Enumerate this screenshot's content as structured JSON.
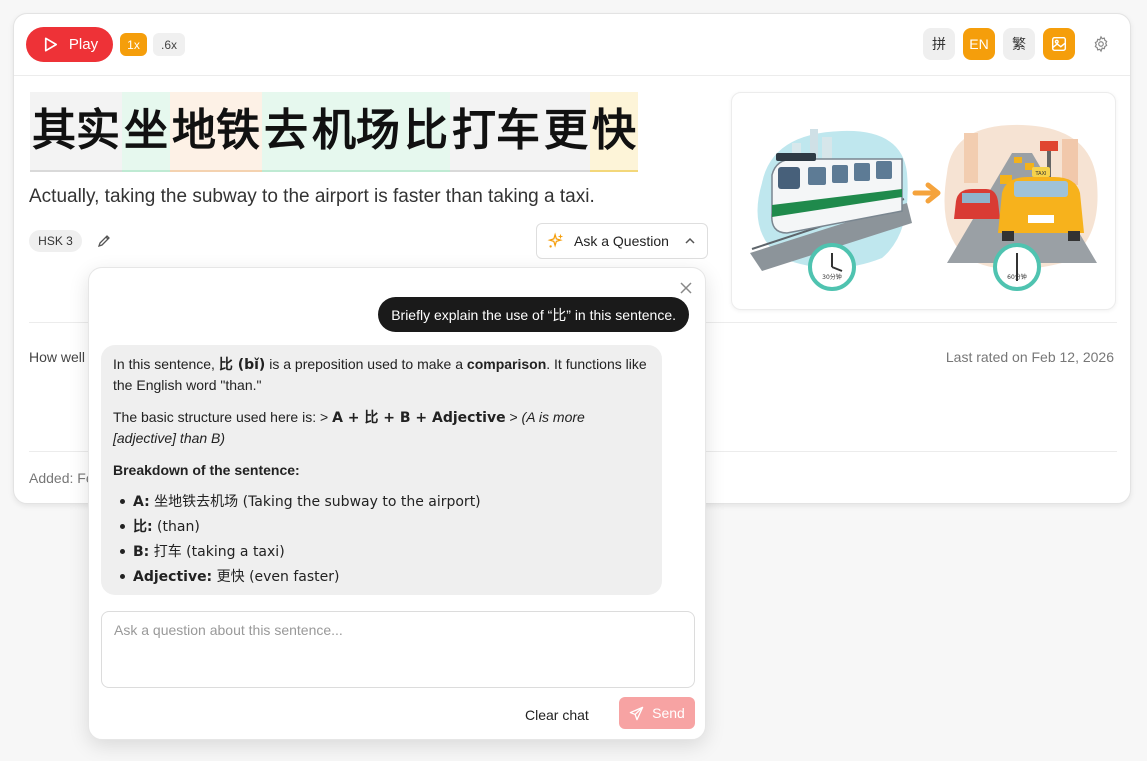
{
  "toolbar": {
    "play_label": "Play",
    "speed_1x": "1x",
    "speed_6x": ".6x",
    "pinyin_label": "拼",
    "english_label": "EN",
    "traditional_label": "繁",
    "image_icon": "image-icon",
    "settings_icon": "gear-icon"
  },
  "sentence": {
    "words": [
      {
        "text": "其实",
        "style": "gray"
      },
      {
        "text": "坐",
        "style": "green"
      },
      {
        "text": "地铁",
        "style": "orange"
      },
      {
        "text": "去",
        "style": "green"
      },
      {
        "text": "机场",
        "style": "green"
      },
      {
        "text": "比",
        "style": "green"
      },
      {
        "text": "打车",
        "style": "gray"
      },
      {
        "text": "更",
        "style": "gray"
      },
      {
        "text": "快",
        "style": "yellow"
      }
    ],
    "translation": "Actually, taking the subway to the airport is faster than taking a taxi.",
    "hsk": "HSK 3"
  },
  "ask_button": {
    "label": "Ask a Question"
  },
  "illustration": {
    "clock1": "30分钟",
    "clock2": "60分钟",
    "taxi_sign": "TAXI"
  },
  "rating": {
    "prompt": "How well",
    "last_rated": "Last rated on Feb 12, 2026"
  },
  "added": "Added: Fe",
  "chat": {
    "user_message": "Briefly explain the use of “比” in this sentence.",
    "bot": {
      "p1_a": "In this sentence, ",
      "p1_b": "比 (bǐ)",
      "p1_c": " is a preposition used to make a ",
      "p1_d": "comparison",
      "p1_e": ". It functions like the English word \"than.\"",
      "p2_a": "The basic structure used here is: > ",
      "p2_b": "A + 比 + B + Adjective",
      "p2_c": " > ",
      "p2_d": "(A is more [adjective] than B)",
      "p3": "Breakdown of the sentence:",
      "items": [
        {
          "label": "A:",
          "text": " 坐地铁去机场 (Taking the subway to the airport)"
        },
        {
          "label": "比:",
          "text": " (than)"
        },
        {
          "label": "B:",
          "text": " 打车 (taking a taxi)"
        },
        {
          "label": "Adjective:",
          "text": " 更快 (even faster)"
        }
      ]
    },
    "input_placeholder": "Ask a question about this sentence...",
    "clear_label": "Clear chat",
    "send_label": "Send"
  },
  "colors": {
    "play": "#ee3237",
    "accent": "#f59e0b",
    "send_disabled": "#f7a3a3"
  }
}
